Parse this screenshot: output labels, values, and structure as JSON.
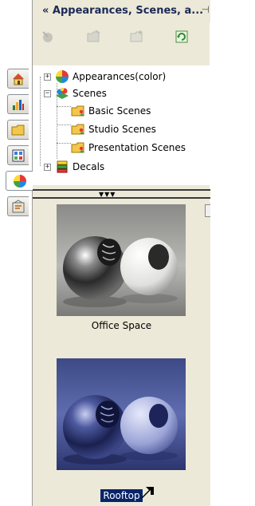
{
  "panel": {
    "title": "« Appearances, Scenes, a...",
    "pin_glyph": "⊣"
  },
  "toolbar": [
    {
      "icon": "apply-appearance-icon"
    },
    {
      "icon": "open-folder-icon"
    },
    {
      "icon": "new-folder-icon"
    },
    {
      "icon": "refresh-icon"
    }
  ],
  "side_tabs": [
    {
      "icon": "home-icon"
    },
    {
      "icon": "chart-icon"
    },
    {
      "icon": "folder-icon"
    },
    {
      "icon": "view-palette-icon"
    },
    {
      "icon": "appearances-icon"
    },
    {
      "icon": "properties-icon"
    }
  ],
  "tree": {
    "items": [
      {
        "label": "Appearances(color)",
        "expander": "+"
      },
      {
        "label": "Scenes",
        "expander": "−"
      },
      {
        "label": "Basic Scenes"
      },
      {
        "label": "Studio Scenes"
      },
      {
        "label": "Presentation Scenes"
      },
      {
        "label": "Decals",
        "expander": "+"
      }
    ]
  },
  "gallery": {
    "items": [
      {
        "label": "Office Space",
        "selected": false
      },
      {
        "label": "Rooftop",
        "selected": true
      }
    ]
  }
}
